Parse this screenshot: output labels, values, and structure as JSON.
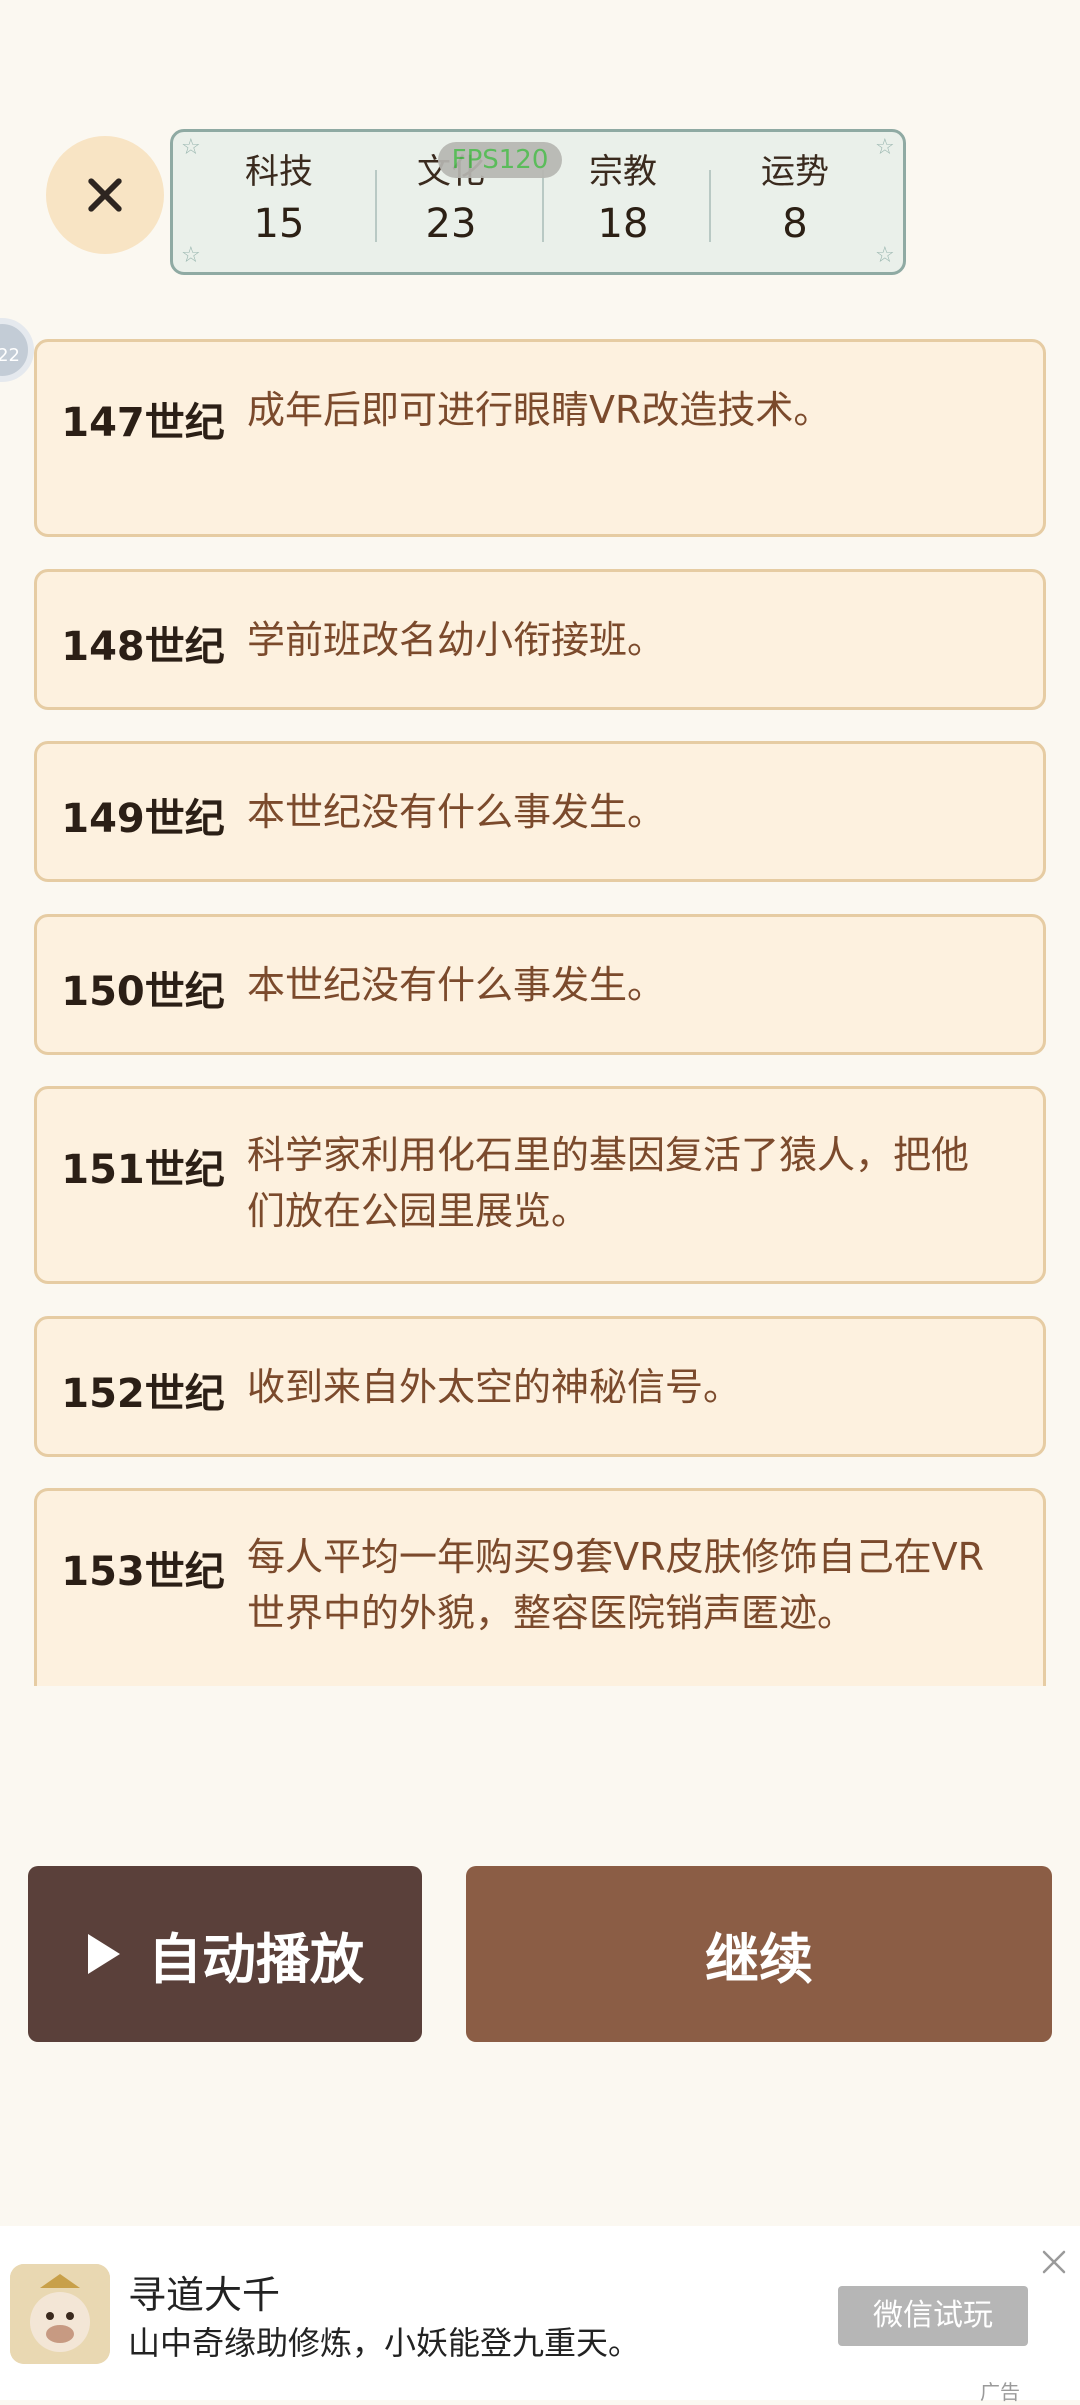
{
  "stats": [
    {
      "label": "科技",
      "value": "15"
    },
    {
      "label": "文化",
      "value": "23"
    },
    {
      "label": "宗教",
      "value": "18"
    },
    {
      "label": "运势",
      "value": "8"
    }
  ],
  "fps_label": "FPS120",
  "side_bubble": "22",
  "events": [
    {
      "century": "147世纪",
      "text": "成年后即可进行眼睛VR改造技术。"
    },
    {
      "century": "148世纪",
      "text": "学前班改名幼小衔接班。"
    },
    {
      "century": "149世纪",
      "text": "本世纪没有什么事发生。"
    },
    {
      "century": "150世纪",
      "text": "本世纪没有什么事发生。"
    },
    {
      "century": "151世纪",
      "text": "科学家利用化石里的基因复活了猿人，把他们放在公园里展览。"
    },
    {
      "century": "152世纪",
      "text": "收到来自外太空的神秘信号。"
    },
    {
      "century": "153世纪",
      "text": "每人平均一年购买9套VR皮肤修饰自己在VR世界中的外貌，整容医院销声匿迹。"
    }
  ],
  "buttons": {
    "auto_play": "自动播放",
    "continue": "继续"
  },
  "ad": {
    "title": "寻道大千",
    "subtitle": "山中奇缘助修炼，小妖能登九重天。",
    "cta": "微信试玩",
    "tag": "广告"
  },
  "colors": {
    "card_bg": "#fdf1df",
    "card_border": "#e6cca3",
    "auto_btn": "#5a403a",
    "continue_btn": "#8b5d45"
  }
}
